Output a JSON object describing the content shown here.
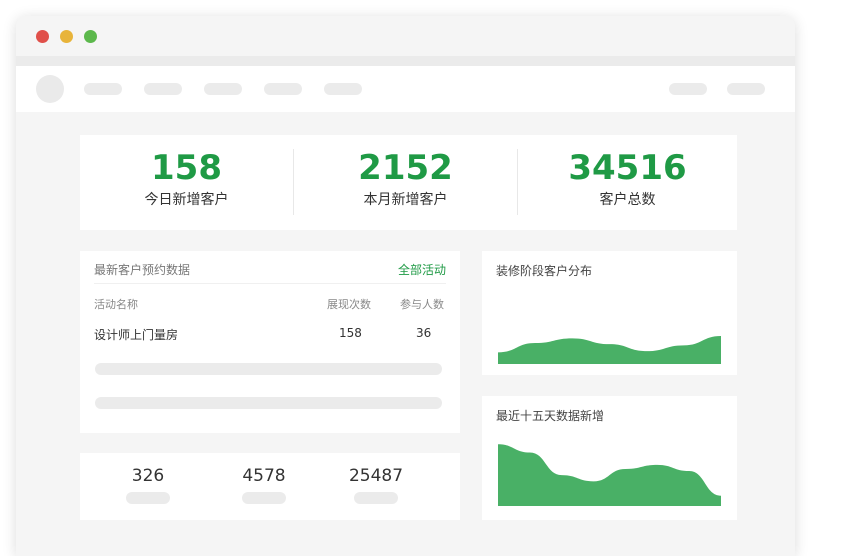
{
  "stats": [
    {
      "value": "158",
      "label": "今日新增客户"
    },
    {
      "value": "2152",
      "label": "本月新增客户"
    },
    {
      "value": "34516",
      "label": "客户总数"
    }
  ],
  "reservation": {
    "title": "最新客户预约数据",
    "link": "全部活动",
    "columns": [
      "活动名称",
      "展现次数",
      "参与人数"
    ],
    "rows": [
      {
        "name": "设计师上门量房",
        "views": "158",
        "participants": "36"
      }
    ]
  },
  "bottom_stats": [
    "326",
    "4578",
    "25487"
  ],
  "chart_data": [
    {
      "type": "area",
      "title": "装修阶段客户分布",
      "x": [
        0,
        1,
        2,
        3,
        4,
        5,
        6
      ],
      "values": [
        10,
        18,
        22,
        17,
        11,
        16,
        24
      ],
      "ylim": [
        0,
        30
      ],
      "color": "#49b066"
    },
    {
      "type": "area",
      "title": "最近十五天数据新增",
      "x": [
        0,
        1,
        2,
        3,
        4,
        5,
        6,
        7
      ],
      "values": [
        60,
        52,
        30,
        24,
        36,
        40,
        34,
        10
      ],
      "ylim": [
        0,
        70
      ],
      "color": "#49b066"
    }
  ],
  "colors": {
    "accent": "#1f9a45",
    "chart": "#49b066",
    "background": "#f5f5f5"
  }
}
